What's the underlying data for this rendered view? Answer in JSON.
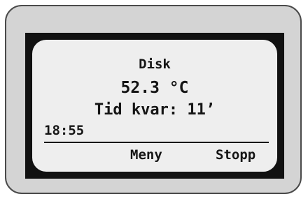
{
  "display": {
    "program": "Disk",
    "temperature": "52.3 °C",
    "time_left": "Tid kvar: 11’",
    "clock": "18:55"
  },
  "softkeys": {
    "menu_label": "Meny",
    "stop_label": "Stopp"
  },
  "colors": {
    "casing": "#d4d4d4",
    "frame": "#111111",
    "screen": "#eeeeee",
    "text": "#151515"
  }
}
